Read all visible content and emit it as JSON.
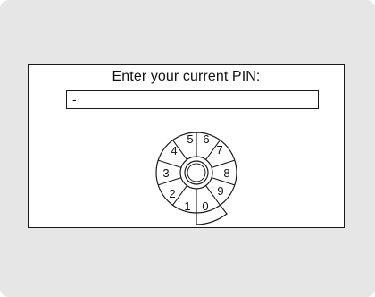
{
  "dialog": {
    "prompt": "Enter your current PIN:",
    "pin_value": "-"
  },
  "dial": {
    "digits": [
      "5",
      "6",
      "7",
      "8",
      "9",
      "0",
      "1",
      "2",
      "3",
      "4"
    ],
    "selected_digit": "0"
  }
}
